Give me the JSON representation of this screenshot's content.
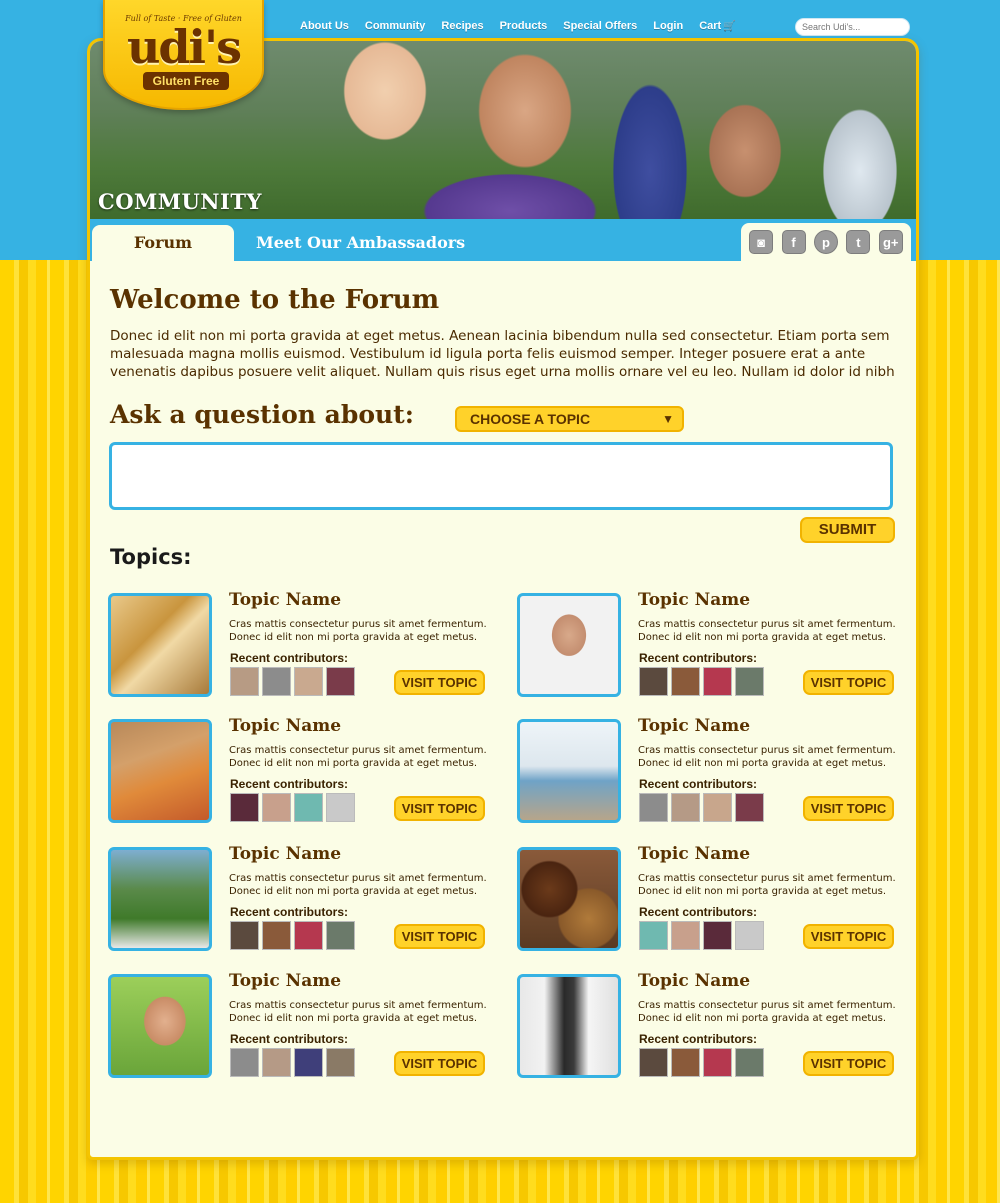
{
  "header": {
    "logo": {
      "tagline": "Full of Taste · Free of Gluten",
      "brand": "udi's",
      "subtitle": "Gluten Free"
    },
    "nav": [
      {
        "label": "About Us"
      },
      {
        "label": "Community"
      },
      {
        "label": "Recipes"
      },
      {
        "label": "Products"
      },
      {
        "label": "Special Offers"
      },
      {
        "label": "Login"
      },
      {
        "label": "Cart"
      }
    ],
    "search": {
      "placeholder": "Search Udi's..."
    },
    "hero_title": "COMMUNITY"
  },
  "tabs": {
    "forum": "Forum",
    "ambassadors": "Meet Our Ambassadors"
  },
  "social": [
    "instagram-icon",
    "facebook-icon",
    "pinterest-icon",
    "twitter-icon",
    "google-plus-icon"
  ],
  "welcome": {
    "title": "Welcome to the Forum",
    "text": "Donec id elit non mi porta gravida at eget metus. Aenean lacinia bibendum nulla sed consectetur. Etiam porta sem malesuada magna mollis euismod. Vestibulum id ligula porta felis euismod semper. Integer posuere erat a ante venenatis dapibus posuere velit aliquet. Nullam quis risus eget urna mollis ornare vel eu leo. Nullam id dolor id nibh"
  },
  "ask": {
    "label": "Ask a question about:",
    "topic_select": "CHOOSE A TOPIC",
    "question_value": "",
    "submit": "SUBMIT"
  },
  "topics_heading": "Topics:",
  "topics": [
    {
      "name": "Topic Name",
      "desc1": "Cras mattis consectetur purus sit amet fermentum.",
      "desc2": "Donec id elit non mi porta gravida at eget metus.",
      "contrib": "Recent contributors:",
      "button": "VISIT TOPIC"
    },
    {
      "name": "Topic Name",
      "desc1": "Cras mattis consectetur purus sit amet fermentum.",
      "desc2": "Donec id elit non mi porta gravida at eget metus.",
      "contrib": "Recent contributors:",
      "button": "VISIT TOPIC"
    },
    {
      "name": "Topic Name",
      "desc1": "Cras mattis consectetur purus sit amet fermentum.",
      "desc2": "Donec id elit non mi porta gravida at eget metus.",
      "contrib": "Recent contributors:",
      "button": "VISIT TOPIC"
    },
    {
      "name": "Topic Name",
      "desc1": "Cras mattis consectetur purus sit amet fermentum.",
      "desc2": "Donec id elit non mi porta gravida at eget metus.",
      "contrib": "Recent contributors:",
      "button": "VISIT TOPIC"
    },
    {
      "name": "Topic Name",
      "desc1": "Cras mattis consectetur purus sit amet fermentum.",
      "desc2": "Donec id elit non mi porta gravida at eget metus.",
      "contrib": "Recent contributors:",
      "button": "VISIT TOPIC"
    },
    {
      "name": "Topic Name",
      "desc1": "Cras mattis consectetur purus sit amet fermentum.",
      "desc2": "Donec id elit non mi porta gravida at eget metus.",
      "contrib": "Recent contributors:",
      "button": "VISIT TOPIC"
    },
    {
      "name": "Topic Name",
      "desc1": "Cras mattis consectetur purus sit amet fermentum.",
      "desc2": "Donec id elit non mi porta gravida at eget metus.",
      "contrib": "Recent contributors:",
      "button": "VISIT TOPIC"
    },
    {
      "name": "Topic Name",
      "desc1": "Cras mattis consectetur purus sit amet fermentum.",
      "desc2": "Donec id elit non mi porta gravida at eget metus.",
      "contrib": "Recent contributors:",
      "button": "VISIT TOPIC"
    }
  ],
  "colors": {
    "accent_blue": "#36b2e3",
    "brand_brown": "#5a3200",
    "button_yellow": "#ffd22a",
    "page_yellow": "#ffd400",
    "card_bg": "#fbfde6"
  }
}
